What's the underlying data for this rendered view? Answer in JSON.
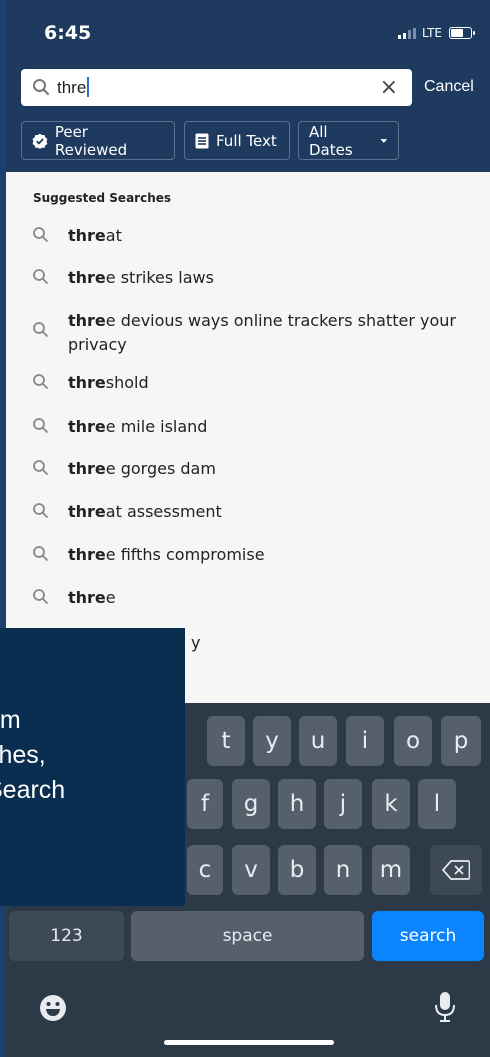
{
  "status": {
    "time": "6:45",
    "network": "LTE"
  },
  "search": {
    "query": "thre",
    "clear": "×",
    "cancel": "Cancel"
  },
  "filters": [
    {
      "label": "Peer Reviewed",
      "icon": "check-badge-icon"
    },
    {
      "label": "Full Text",
      "icon": "document-icon"
    },
    {
      "label": "All Dates",
      "icon": "caret-down-icon"
    }
  ],
  "suggestions": {
    "title": "Suggested Searches",
    "items": [
      {
        "match": "thre",
        "rest": "at"
      },
      {
        "match": "thre",
        "rest": "e strikes laws"
      },
      {
        "match": "thre",
        "rest": "e devious ways online trackers shatter your privacy"
      },
      {
        "match": "thre",
        "rest": "shold"
      },
      {
        "match": "thre",
        "rest": "e mile island"
      },
      {
        "match": "thre",
        "rest": "e gorges dam"
      },
      {
        "match": "thre",
        "rest": "at assessment"
      },
      {
        "match": "thre",
        "rest": "e fifths compromise"
      },
      {
        "match": "thre",
        "rest": "e"
      },
      {
        "match": "",
        "rest": "y"
      }
    ]
  },
  "keyboard": {
    "row1": [
      "t",
      "y",
      "u",
      "i",
      "o",
      "p"
    ],
    "row2": [
      "f",
      "g",
      "h",
      "j",
      "k",
      "l"
    ],
    "row3": [
      "c",
      "v",
      "b",
      "n",
      "m"
    ],
    "numbers": "123",
    "space": "space",
    "go": "search"
  },
  "overlay": {
    "lines": [
      "om",
      "ches,",
      "Search"
    ]
  },
  "colors": {
    "header": "#1e3a5e",
    "accent": "#0a84ff",
    "overlay": "#0a2e50"
  }
}
